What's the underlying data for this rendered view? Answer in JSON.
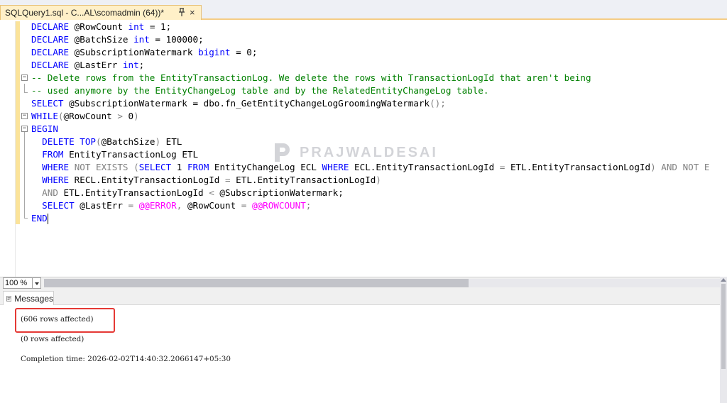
{
  "tab": {
    "title": "SQLQuery1.sql - C...AL\\scomadmin (64))*",
    "close_glyph": "×",
    "pin_icon": "pin-icon"
  },
  "code_lines": [
    [
      [
        "kw",
        "DECLARE"
      ],
      [
        "plain",
        " @RowCount "
      ],
      [
        "kw",
        "int"
      ],
      [
        "plain",
        " = 1;"
      ]
    ],
    [
      [
        "kw",
        "DECLARE"
      ],
      [
        "plain",
        " @BatchSize "
      ],
      [
        "kw",
        "int"
      ],
      [
        "plain",
        " = 100000;"
      ]
    ],
    [
      [
        "kw",
        "DECLARE"
      ],
      [
        "plain",
        " @SubscriptionWatermark "
      ],
      [
        "kw",
        "bigint"
      ],
      [
        "plain",
        " = 0;"
      ]
    ],
    [
      [
        "kw",
        "DECLARE"
      ],
      [
        "plain",
        " @LastErr "
      ],
      [
        "kw",
        "int"
      ],
      [
        "plain",
        ";"
      ]
    ],
    [
      [
        "cm",
        "-- Delete rows from the EntityTransactionLog. We delete the rows with TransactionLogId that aren't being"
      ]
    ],
    [
      [
        "cm",
        "-- used anymore by the EntityChangeLog table and by the RelatedEntityChangeLog table."
      ]
    ],
    [
      [
        "kw",
        "SELECT"
      ],
      [
        "plain",
        " @SubscriptionWatermark = dbo.fn_GetEntityChangeLogGroomingWatermark"
      ],
      [
        "gy",
        "();"
      ]
    ],
    [
      [
        "kw",
        "WHILE"
      ],
      [
        "gy",
        "("
      ],
      [
        "plain",
        "@RowCount "
      ],
      [
        "gy",
        ">"
      ],
      [
        "plain",
        " 0"
      ],
      [
        "gy",
        ")"
      ]
    ],
    [
      [
        "kw",
        "BEGIN"
      ]
    ],
    [
      [
        "plain",
        "  "
      ],
      [
        "kw",
        "DELETE"
      ],
      [
        "plain",
        " "
      ],
      [
        "kw",
        "TOP"
      ],
      [
        "gy",
        "("
      ],
      [
        "plain",
        "@BatchSize"
      ],
      [
        "gy",
        ")"
      ],
      [
        "plain",
        " ETL"
      ]
    ],
    [
      [
        "plain",
        "  "
      ],
      [
        "kw",
        "FROM"
      ],
      [
        "plain",
        " EntityTransactionLog ETL"
      ]
    ],
    [
      [
        "plain",
        "  "
      ],
      [
        "kw",
        "WHERE"
      ],
      [
        "plain",
        " "
      ],
      [
        "gy",
        "NOT EXISTS"
      ],
      [
        "plain",
        " "
      ],
      [
        "gy",
        "("
      ],
      [
        "kw",
        "SELECT"
      ],
      [
        "plain",
        " 1 "
      ],
      [
        "kw",
        "FROM"
      ],
      [
        "plain",
        " EntityChangeLog ECL "
      ],
      [
        "kw",
        "WHERE"
      ],
      [
        "plain",
        " ECL.EntityTransactionLogId "
      ],
      [
        "gy",
        "="
      ],
      [
        "plain",
        " ETL.EntityTransactionLogId"
      ],
      [
        "gy",
        ")"
      ],
      [
        "plain",
        " "
      ],
      [
        "gy",
        "AND NOT E"
      ]
    ],
    [
      [
        "plain",
        "  "
      ],
      [
        "kw",
        "WHERE"
      ],
      [
        "plain",
        " RECL.EntityTransactionLogId "
      ],
      [
        "gy",
        "="
      ],
      [
        "plain",
        " ETL.EntityTransactionLogId"
      ],
      [
        "gy",
        ")"
      ]
    ],
    [
      [
        "plain",
        "  "
      ],
      [
        "gy",
        "AND"
      ],
      [
        "plain",
        " ETL.EntityTransactionLogId "
      ],
      [
        "gy",
        "<"
      ],
      [
        "plain",
        " @SubscriptionWatermark;"
      ]
    ],
    [
      [
        "plain",
        "  "
      ],
      [
        "kw",
        "SELECT"
      ],
      [
        "plain",
        " @LastErr "
      ],
      [
        "gy",
        "="
      ],
      [
        "plain",
        " "
      ],
      [
        "fn",
        "@@ERROR"
      ],
      [
        "gy",
        ","
      ],
      [
        "plain",
        " @RowCount "
      ],
      [
        "gy",
        "="
      ],
      [
        "plain",
        " "
      ],
      [
        "fn",
        "@@ROWCOUNT"
      ],
      [
        "gy",
        ";"
      ]
    ],
    [
      [
        "kw",
        "END"
      ]
    ]
  ],
  "watermark": {
    "text": "PRAJWALDESAI"
  },
  "zoom": {
    "value": "100 %"
  },
  "results": {
    "tab_label": "Messages",
    "lines": [
      "(606 rows affected)",
      "(0 rows affected)",
      "Completion time: 2026-02-02T14:40:32.2066147+05:30"
    ]
  },
  "colors": {
    "keyword": "#0000ff",
    "comment": "#008000",
    "operator": "#808080",
    "system_function": "#ff00ff",
    "highlight_border": "#e53935",
    "tab_active": "#fff0c8"
  }
}
